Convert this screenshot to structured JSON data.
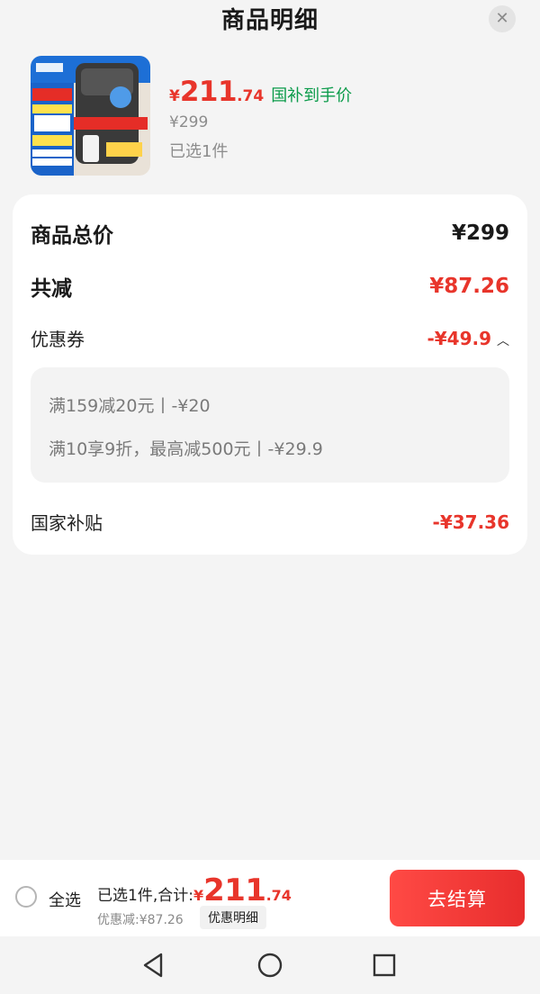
{
  "header": {
    "title": "商品明细",
    "close_icon": "close-icon"
  },
  "product": {
    "image_icon": "product-image",
    "price_symbol": "¥",
    "price_int": "211",
    "price_dec": ".74",
    "price_tag": "国补到手价",
    "original_price": "¥299",
    "selected": "已选1件"
  },
  "details": {
    "total_label": "商品总价",
    "total_value": "¥299",
    "reduce_label": "共减",
    "reduce_value": "¥87.26",
    "coupon_label": "优惠券",
    "coupon_value": "-¥49.9",
    "coupons": [
      "满159减20元丨-¥20",
      "满10享9折，最高减500元丨-¥29.9"
    ],
    "subsidy_label": "国家补贴",
    "subsidy_value": "-¥37.36"
  },
  "bottom": {
    "select_all": "全选",
    "summary_label": "已选1件,合计:",
    "total_symbol": "¥",
    "total_int": "211",
    "total_dec": ".74",
    "discount": "优惠减:¥87.26",
    "detail_button": "优惠明细",
    "checkout_button": "去结算"
  },
  "colors": {
    "accent_red": "#e8352b",
    "green": "#0a9b4a"
  }
}
